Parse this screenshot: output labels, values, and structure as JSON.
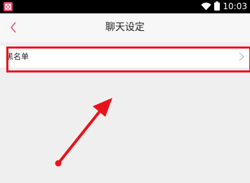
{
  "status_bar": {
    "time": "10:03",
    "app_icon": "notification-app-icon",
    "wifi_icon": "wifi-icon",
    "battery_icon": "battery-icon"
  },
  "nav": {
    "back_icon": "back-chevron-icon",
    "title": "聊天设定"
  },
  "list": {
    "items": [
      {
        "label": "黑名单",
        "icon": "chevron-right-icon"
      }
    ]
  },
  "annotation": {
    "highlight_color": "#e8141b",
    "arrow_color": "#e8141b"
  },
  "colors": {
    "accent": "#e0466a",
    "page_background": "#efefef",
    "nav_background": "#f7f7f7"
  }
}
